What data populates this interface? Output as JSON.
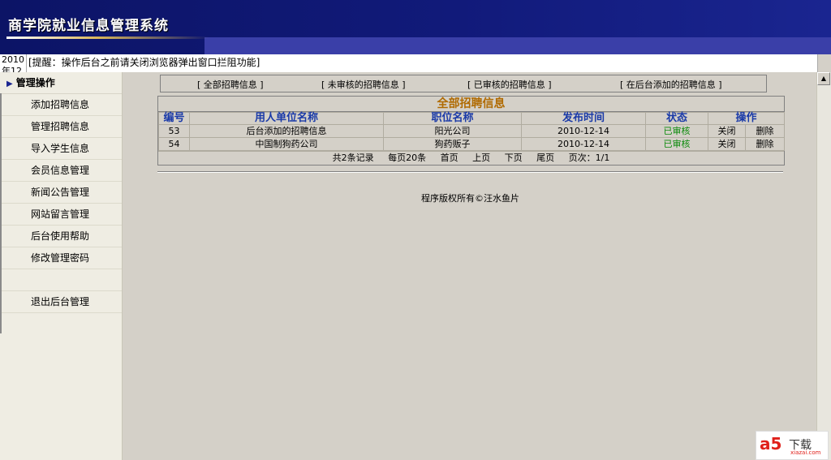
{
  "header": {
    "title": "商学院就业信息管理系统"
  },
  "notice": {
    "date": "2010年12",
    "text": "[提醒：操作后台之前请关闭浏览器弹出窗口拦阻功能]"
  },
  "sidebar": {
    "heading": "管理操作",
    "items": [
      {
        "label": "添加招聘信息"
      },
      {
        "label": "管理招聘信息"
      },
      {
        "label": "导入学生信息"
      },
      {
        "label": "会员信息管理"
      },
      {
        "label": "新闻公告管理"
      },
      {
        "label": "网站留言管理"
      },
      {
        "label": "后台使用帮助"
      },
      {
        "label": "修改管理密码"
      }
    ],
    "logout": "退出后台管理"
  },
  "filters": [
    {
      "label": "[ 全部招聘信息 ]"
    },
    {
      "label": "[ 未审核的招聘信息 ]"
    },
    {
      "label": "[ 已审核的招聘信息 ]"
    },
    {
      "label": "[ 在后台添加的招聘信息 ]"
    }
  ],
  "list": {
    "caption": "全部招聘信息",
    "columns": [
      "编号",
      "用人单位名称",
      "职位名称",
      "发布时间",
      "状态",
      "操作"
    ],
    "rows": [
      {
        "id": "53",
        "company": "后台添加的招聘信息",
        "position": "阳光公司",
        "date": "2010-12-14",
        "status": "已审核",
        "close": "关闭",
        "delete": "删除"
      },
      {
        "id": "54",
        "company": "中国制狗药公司",
        "position": "狗药贩子",
        "date": "2010-12-14",
        "status": "已审核",
        "close": "关闭",
        "delete": "删除"
      }
    ]
  },
  "pager": {
    "total": "共2条记录",
    "per_page": "每页20条",
    "first": "首页",
    "prev": "上页",
    "next": "下页",
    "last": "尾页",
    "page": "页次：1/1"
  },
  "footer": {
    "copyright": "程序版权所有©汪水鱼片"
  },
  "watermark": {
    "logo": "a5",
    "text": "下载",
    "site": "xiazai.com"
  },
  "colors": {
    "header_bg": "#111a7a",
    "status_green": "#0a8a0a",
    "caption": "#b06a00",
    "column_header": "#1a3aa8"
  }
}
